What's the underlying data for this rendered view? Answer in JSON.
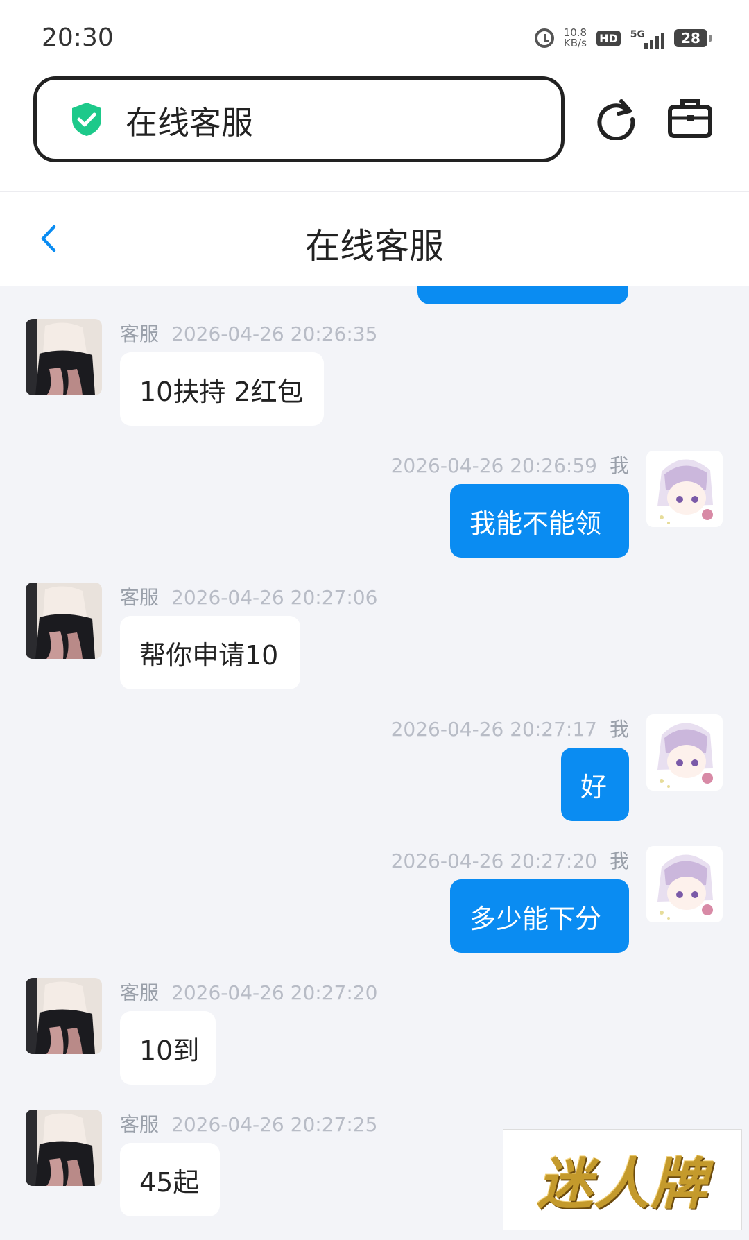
{
  "status_bar": {
    "time": "20:30",
    "net_speed_value": "10.8",
    "net_speed_unit": "KB/s",
    "hd_label": "HD",
    "network_label": "5G",
    "battery_level": "28"
  },
  "browser": {
    "url_text": "在线客服",
    "secure_icon": "shield-check-icon",
    "refresh_icon": "refresh-icon",
    "toolbox_icon": "toolbox-icon"
  },
  "header": {
    "title": "在线客服",
    "back_icon": "chevron-left-icon"
  },
  "colors": {
    "accent": "#0a8cf2",
    "shield": "#1dc98a",
    "background": "#f3f4f8"
  },
  "messages": [
    {
      "side": "left",
      "sender": "客服",
      "time": "2026-04-26 20:26:35",
      "text": "10扶持 2红包"
    },
    {
      "side": "right",
      "sender": "我",
      "time": "2026-04-26 20:26:59",
      "text": "我能不能领"
    },
    {
      "side": "left",
      "sender": "客服",
      "time": "2026-04-26 20:27:06",
      "text": "帮你申请10"
    },
    {
      "side": "right",
      "sender": "我",
      "time": "2026-04-26 20:27:17",
      "text": "好"
    },
    {
      "side": "right",
      "sender": "我",
      "time": "2026-04-26 20:27:20",
      "text": "多少能下分"
    },
    {
      "side": "left",
      "sender": "客服",
      "time": "2026-04-26 20:27:20",
      "text": "10到"
    },
    {
      "side": "left",
      "sender": "客服",
      "time": "2026-04-26 20:27:25",
      "text": "45起"
    }
  ],
  "watermark": {
    "text": "迷人牌"
  }
}
